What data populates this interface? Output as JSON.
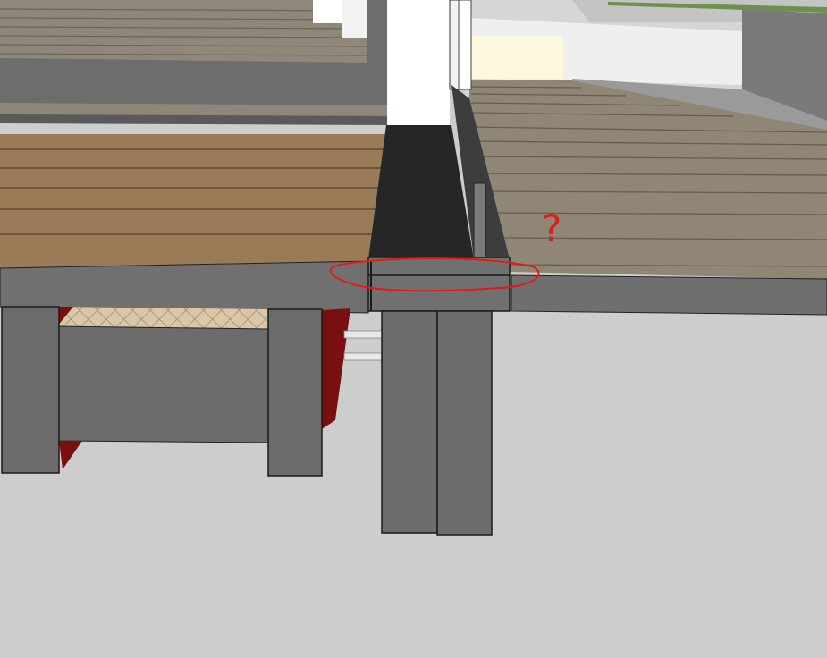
{
  "scene": {
    "kind": "3d-model-viewport",
    "colors": {
      "background": "#cfcfcf",
      "ground": "#cdcdcd",
      "deck_brown": "#9b7a57",
      "deck_gray": "#8f8676",
      "beam": "#6e6e6e",
      "post": "#6c6c6c",
      "dark_channel": "#2b2b2b",
      "rail_white": "#ffffff",
      "shadow_red": "#7a0f0f",
      "markup_red": "#e11a1a",
      "lattice": "#d9c7a8"
    },
    "markup": {
      "question_mark": "?"
    }
  }
}
